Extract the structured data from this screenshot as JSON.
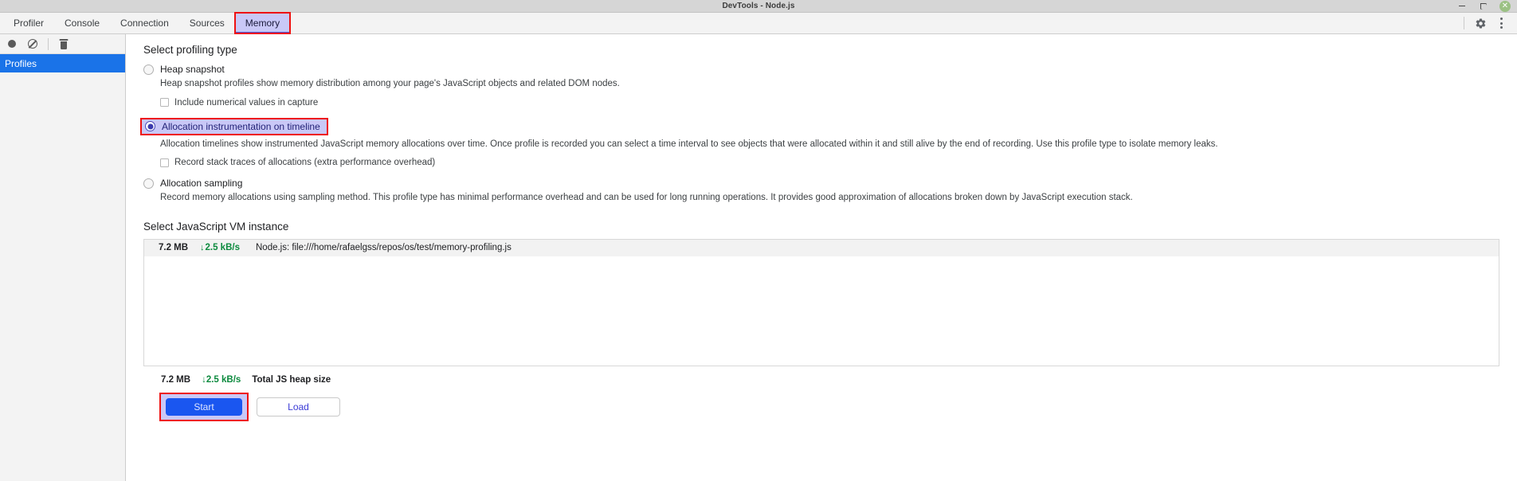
{
  "window": {
    "title": "DevTools - Node.js",
    "controls": {
      "minimize": "minimize",
      "maximize": "maximize",
      "close": "✕"
    }
  },
  "tabbar": {
    "tabs": [
      {
        "label": "Profiler",
        "active": false
      },
      {
        "label": "Console",
        "active": false
      },
      {
        "label": "Connection",
        "active": false
      },
      {
        "label": "Sources",
        "active": false
      },
      {
        "label": "Memory",
        "active": true
      }
    ],
    "settings_icon": "gear-icon",
    "more_icon": "more-vertical-icon"
  },
  "sidebar": {
    "toolbar": {
      "record": "record-icon",
      "clear": "no-entry-icon",
      "delete": "trash-icon"
    },
    "items": [
      {
        "label": "Profiles",
        "selected": true
      }
    ]
  },
  "main": {
    "profiling_section_title": "Select profiling type",
    "options": [
      {
        "label": "Heap snapshot",
        "selected": false,
        "description": "Heap snapshot profiles show memory distribution among your page's JavaScript objects and related DOM nodes.",
        "suboption": {
          "label": "Include numerical values in capture",
          "checked": false
        }
      },
      {
        "label": "Allocation instrumentation on timeline",
        "selected": true,
        "highlighted": true,
        "description": "Allocation timelines show instrumented JavaScript memory allocations over time. Once profile is recorded you can select a time interval to see objects that were allocated within it and still alive by the end of recording. Use this profile type to isolate memory leaks.",
        "suboption": {
          "label": "Record stack traces of allocations (extra performance overhead)",
          "checked": false
        }
      },
      {
        "label": "Allocation sampling",
        "selected": false,
        "description": "Record memory allocations using sampling method. This profile type has minimal performance overhead and can be used for long running operations. It provides good approximation of allocations broken down by JavaScript execution stack.",
        "suboption": null
      }
    ],
    "vm_section_title": "Select JavaScript VM instance",
    "vm_rows": [
      {
        "size": "7.2 MB",
        "rate_arrow": "↓",
        "rate": "2.5 kB/s",
        "name": "Node.js: file:///home/rafaelgss/repos/os/test/memory-profiling.js"
      }
    ],
    "totals": {
      "size": "7.2 MB",
      "rate_arrow": "↓",
      "rate": "2.5 kB/s",
      "label": "Total JS heap size"
    },
    "buttons": {
      "start": "Start",
      "load": "Load"
    }
  },
  "colors": {
    "accent_blue": "#1a56f0",
    "selection_blue": "#1a73e8",
    "highlight_purple": "#c9c8f7",
    "highlight_red": "#ee1111",
    "rate_green": "#0c8a3e"
  }
}
